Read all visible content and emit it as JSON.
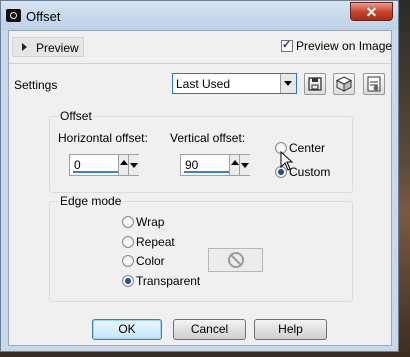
{
  "window": {
    "title": "Offset",
    "close_glyph": "✕",
    "app_icon": "camera-icon"
  },
  "preview": {
    "label": "Preview",
    "preview_on_image_label": "Preview on Image",
    "preview_on_image_checked": true
  },
  "settings": {
    "label": "Settings",
    "preset_value": "Last Used",
    "icons": [
      "save-icon",
      "randomize-icon",
      "reset-icon"
    ]
  },
  "offset_group": {
    "title": "Offset",
    "horizontal_label": "Horizontal offset:",
    "horizontal_value": "0",
    "vertical_label": "Vertical offset:",
    "vertical_value": "90",
    "center_label": "Center",
    "custom_label": "Custom",
    "selected": "Custom"
  },
  "edge_group": {
    "title": "Edge mode",
    "options": [
      "Wrap",
      "Repeat",
      "Color",
      "Transparent"
    ],
    "selected": "Transparent",
    "color_swatch_icon": "no-color-icon"
  },
  "buttons": {
    "ok": "OK",
    "cancel": "Cancel",
    "help": "Help"
  }
}
